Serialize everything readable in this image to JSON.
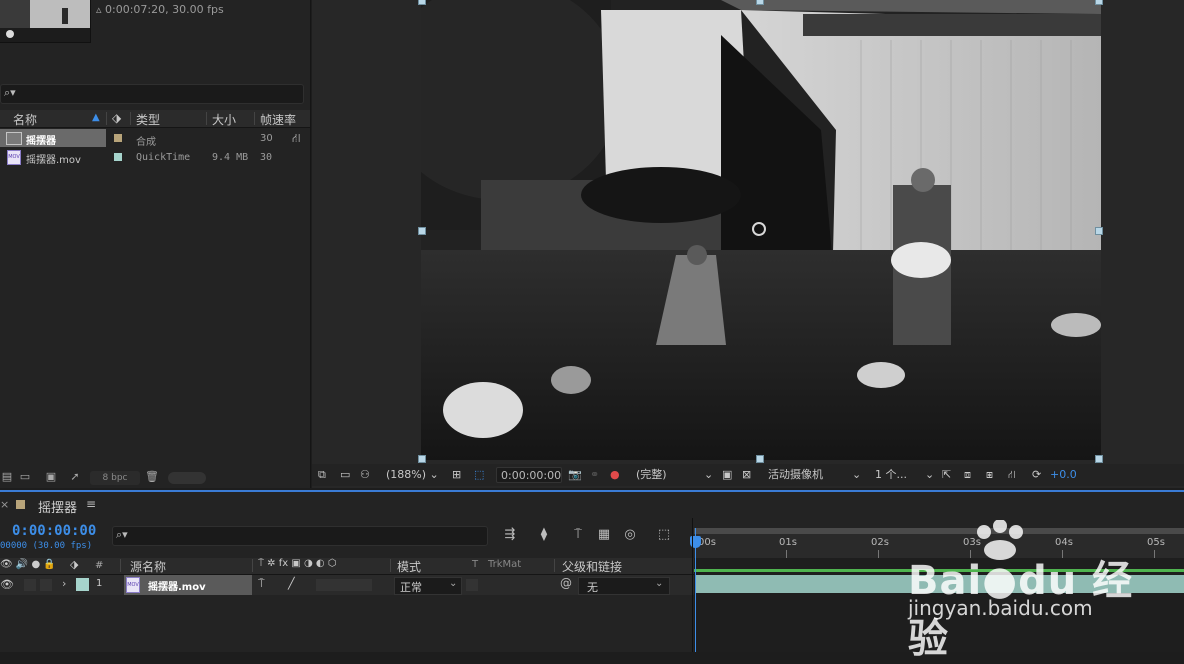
{
  "project": {
    "thumb_info": "▵ 0:00:07:20, 30.00 fps",
    "search_placeholder": "",
    "columns": {
      "name": "名称",
      "type": "类型",
      "size": "大小",
      "fps": "帧速率"
    },
    "items": [
      {
        "name": "摇摆器",
        "type": "合成",
        "size": "",
        "fps": "30",
        "color": "#b8a47a",
        "selected": true
      },
      {
        "name": "摇摆器.mov",
        "type": "QuickTime",
        "size": "9.4 MB",
        "fps": "30",
        "color": "#a6d4cc",
        "selected": false
      }
    ],
    "bpc_label": "8 bpc"
  },
  "viewer": {
    "zoom": "(188%)",
    "timecode": "0:00:00:00",
    "resolution": "(完整)",
    "camera": "活动摄像机",
    "views": "1 个...",
    "exposure": "+0.0"
  },
  "timeline": {
    "tab_name": "摇摆器",
    "timecode": "0:00:00:00",
    "timecode_sub": "00000 (30.00 fps)",
    "columns": {
      "number": "#",
      "source_name": "源名称",
      "mode": "模式",
      "t": "T",
      "trkmat": "TrkMat",
      "parent": "父级和链接"
    },
    "layer": {
      "number": "1",
      "name": "摇摆器.mov",
      "mode": "正常",
      "parent": "无",
      "color": "#a6d4cc"
    },
    "ruler_ticks": [
      "00s",
      "01s",
      "02s",
      "03s",
      "04s",
      "05s"
    ]
  },
  "watermark": {
    "brand": "Bai●du 经验",
    "url": "jingyan.baidu.com"
  },
  "colors": {
    "accent": "#3d8ee8",
    "track_bar": "#8fbbb3",
    "selection_handle": "#b9d7e7"
  }
}
